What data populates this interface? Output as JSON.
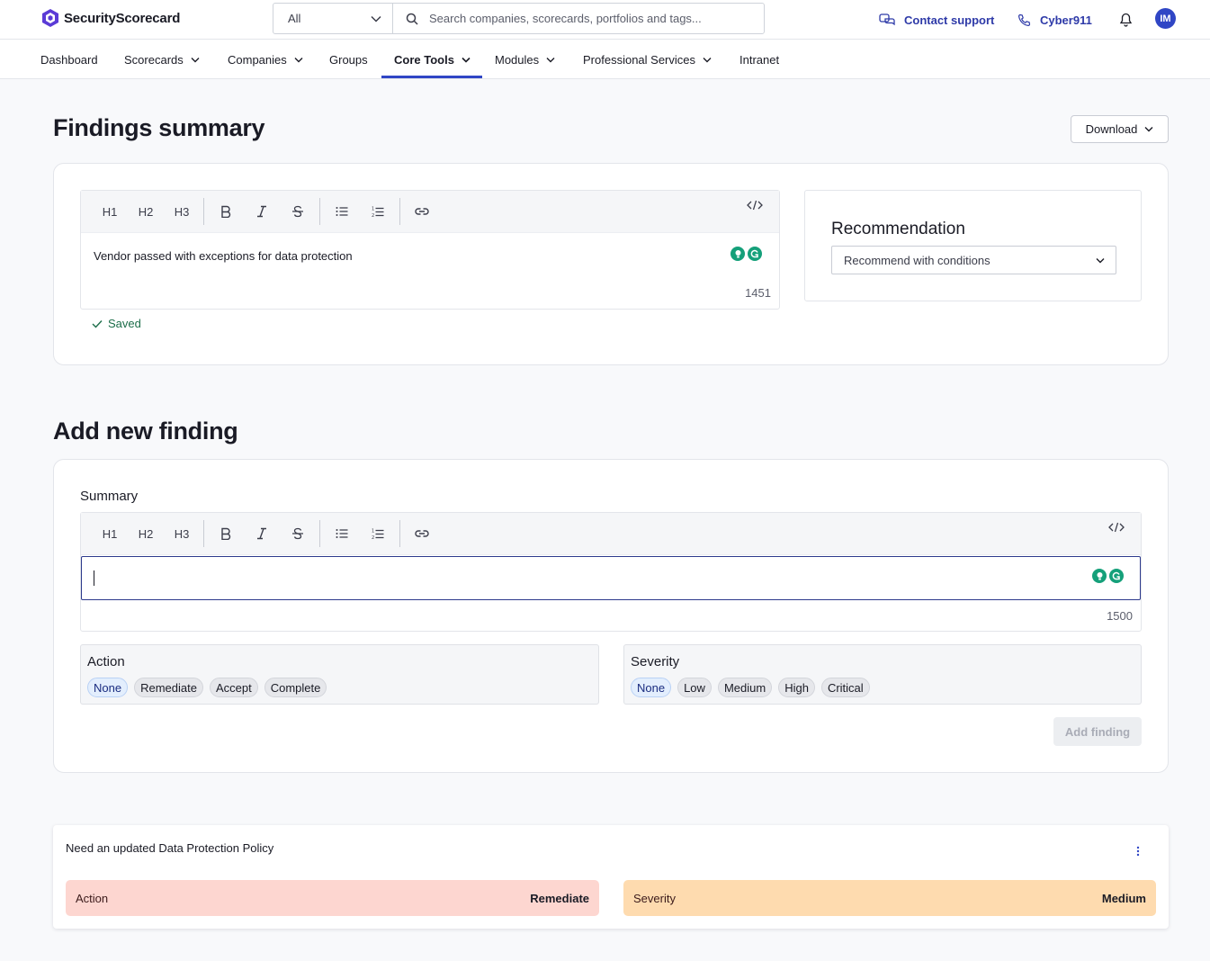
{
  "brand": {
    "name": "SecurityScorecard"
  },
  "search": {
    "scope": "All",
    "placeholder": "Search companies, scorecards, portfolios and tags..."
  },
  "header_links": {
    "contact": "Contact support",
    "cyber": "Cyber911",
    "avatar_initials": "IM"
  },
  "nav": {
    "items": [
      {
        "label": "Dashboard"
      },
      {
        "label": "Scorecards"
      },
      {
        "label": "Companies"
      },
      {
        "label": "Groups"
      },
      {
        "label": "Core Tools"
      },
      {
        "label": "Modules"
      },
      {
        "label": "Professional Services"
      },
      {
        "label": "Intranet"
      }
    ]
  },
  "findings_summary": {
    "title": "Findings summary",
    "download_label": "Download",
    "toolbar": {
      "h1": "H1",
      "h2": "H2",
      "h3": "H3"
    },
    "text": "Vendor passed with exceptions for data protection",
    "char_count": "1451",
    "saved_label": "Saved",
    "recommendation": {
      "title": "Recommendation",
      "selected": "Recommend with conditions"
    }
  },
  "add_finding": {
    "title": "Add new finding",
    "summary_label": "Summary",
    "char_count": "1500",
    "action": {
      "label": "Action",
      "options": [
        "None",
        "Remediate",
        "Accept",
        "Complete"
      ],
      "selected": "None"
    },
    "severity": {
      "label": "Severity",
      "options": [
        "None",
        "Low",
        "Medium",
        "High",
        "Critical"
      ],
      "selected": "None"
    },
    "submit_label": "Add finding"
  },
  "finding_item": {
    "title": "Need an updated Data Protection Policy",
    "action_label": "Action",
    "action_value": "Remediate",
    "severity_label": "Severity",
    "severity_value": "Medium"
  },
  "colors": {
    "accent": "#3046c5",
    "action_tag": "#fdd6d0",
    "severity_tag": "#fedbaf",
    "saved_green": "#1d6e4a",
    "grammarly": "#15a07a"
  }
}
